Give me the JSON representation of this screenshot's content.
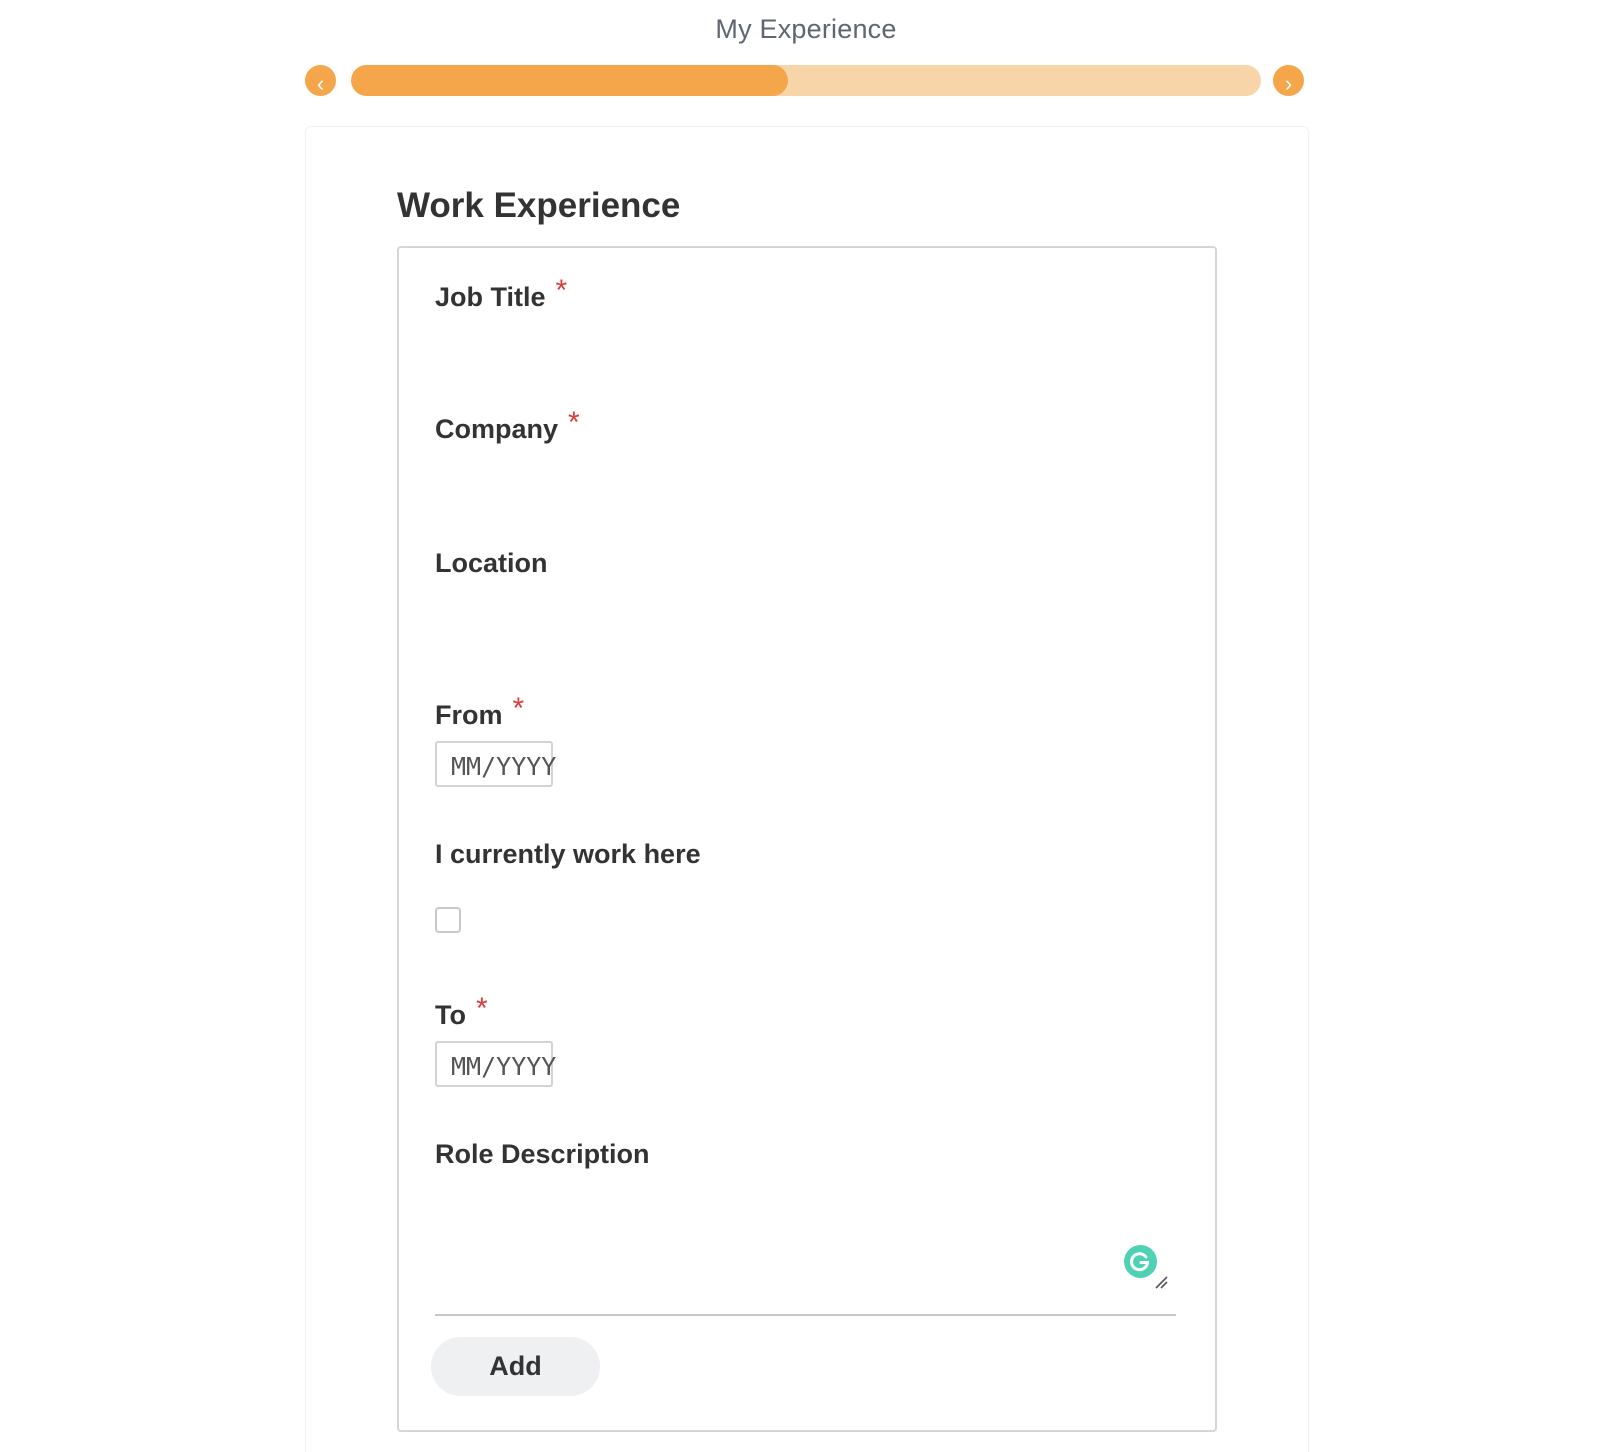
{
  "progress": {
    "title": "My Experience",
    "fraction": 0.48,
    "prev_glyph": "‹",
    "next_glyph": "›",
    "colors": {
      "fill": "#f5a54a",
      "track": "#f8d5a8"
    }
  },
  "section": {
    "title": "Work Experience"
  },
  "form": {
    "job_title_label": "Job Title",
    "company_label": "Company",
    "location_label": "Location",
    "from_label": "From",
    "from_placeholder": "MM/YYYY",
    "current_label": "I currently work here",
    "to_label": "To",
    "to_placeholder": "MM/YYYY",
    "role_description_label": "Role Description",
    "required_mark": "*"
  },
  "actions": {
    "add_label": "Add"
  },
  "icons": {
    "prev": "chevron-left-icon",
    "next": "chevron-right-icon",
    "grammarly": "grammarly-icon",
    "resize": "resize-handle-icon"
  }
}
